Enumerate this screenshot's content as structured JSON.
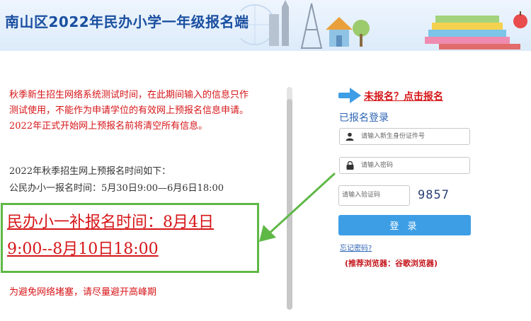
{
  "header": {
    "title": "南山区2022年民办小学一年级报名端"
  },
  "notice": {
    "text": "秋季新生招生网络系统测试时间，在此期间输入的信息只作测试使用，不能作为申请学位的有效网上预报名信息申请。2022年正式开始网上预报名前将清空所有信息。",
    "schedule_title": "2022年秋季招生网上预报名时间如下：",
    "schedule_line": "公民办小一报名时间：5月30日9:00—6月6日18:00",
    "supplement": "民办小一补报名时间：8月4日9:00--8月10日18:00",
    "avoid_peak": "为避免网络堵塞，请尽量避开高峰期"
  },
  "login": {
    "register_link": "未报名？点击报名",
    "section_title": "已报名登录",
    "id_placeholder": "请输入新生身份证件号",
    "password_placeholder": "请输入密码",
    "captcha_placeholder": "请输入验证码",
    "captcha_code": "9857",
    "login_button": "登 录",
    "forgot_password": "忘记密码?",
    "recommend_browser": "(推荐浏览器：谷歌浏览器)"
  },
  "colors": {
    "title_blue": "#1a4fa0",
    "notice_red": "#d61518",
    "highlight_green": "#5fb846",
    "button_blue": "#3e9ee5"
  },
  "icons": {
    "user": "user-icon",
    "lock": "lock-icon",
    "pointer": "arrow-right-icon",
    "highlight": "green-arrow-icon"
  }
}
